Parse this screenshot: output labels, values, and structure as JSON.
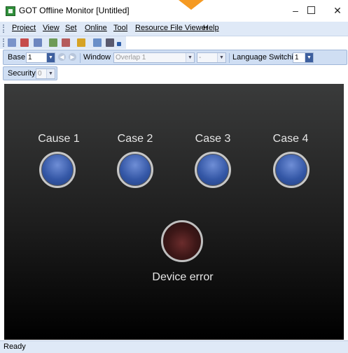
{
  "window": {
    "title": "GOT Offline Monitor  [Untitled]",
    "min_glyph": "–",
    "close_glyph": "✕"
  },
  "menu": [
    {
      "label": "Project"
    },
    {
      "label": "View"
    },
    {
      "label": "Set"
    },
    {
      "label": "Online"
    },
    {
      "label": "Tool"
    },
    {
      "label": "Resource File Viewer"
    },
    {
      "label": "Help"
    }
  ],
  "toolbar": {
    "base_label": "Base",
    "base_value": "1",
    "window_label": "Window",
    "window_value": "Overlap 1",
    "window_sub_value": "-",
    "language_label": "Language Switching",
    "language_value": "1",
    "security_label": "Security",
    "security_value": "0"
  },
  "monitor": {
    "indicators": [
      {
        "label": "Cause 1",
        "color": "#3457a6"
      },
      {
        "label": "Case 2",
        "color": "#3457a6"
      },
      {
        "label": "Case 3",
        "color": "#3457a6"
      },
      {
        "label": "Case 4",
        "color": "#3457a6"
      }
    ],
    "device_error": {
      "label": "Device error",
      "color": "#3d1717"
    }
  },
  "status": {
    "text": "Ready"
  },
  "icons": [
    "app-icon",
    "minimize-icon",
    "maximize-icon",
    "close-icon",
    "chevron-down-icon",
    "back-icon",
    "forward-icon"
  ],
  "colors": {
    "accent_arrow": "#f59a23",
    "menubar": "#dfe9f7",
    "toolbar": "#cfdef3"
  }
}
